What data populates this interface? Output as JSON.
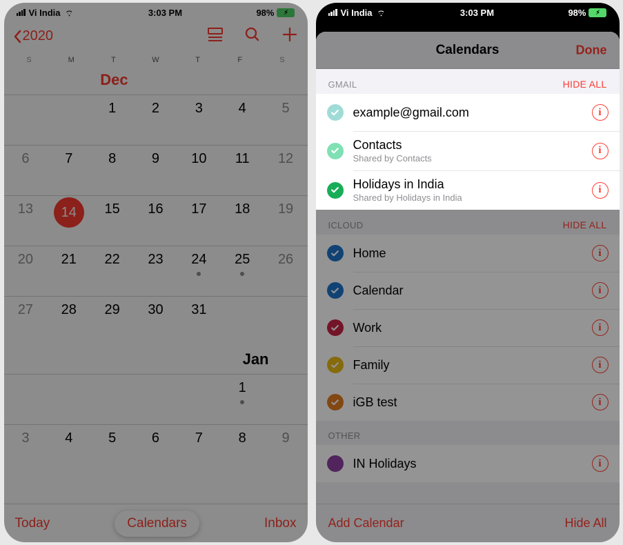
{
  "status": {
    "carrier": "Vi India",
    "time": "3:03 PM",
    "battery_pct": "98%",
    "battery_icon_text": "⚡︎"
  },
  "phone1": {
    "back_year": "2020",
    "weekdays": [
      "S",
      "M",
      "T",
      "W",
      "T",
      "F",
      "S"
    ],
    "month_dec": "Dec",
    "month_jan": "Jan",
    "rows": {
      "r1": [
        "",
        "",
        "1",
        "2",
        "3",
        "4",
        "5"
      ],
      "r2": [
        "6",
        "7",
        "8",
        "9",
        "10",
        "11",
        "12"
      ],
      "r3": [
        "13",
        "14",
        "15",
        "16",
        "17",
        "18",
        "19"
      ],
      "r4": [
        "20",
        "21",
        "22",
        "23",
        "24",
        "25",
        "26"
      ],
      "r5": [
        "27",
        "28",
        "29",
        "30",
        "31",
        "",
        ""
      ],
      "r7": [
        "",
        "",
        "",
        "",
        "",
        "1",
        ""
      ],
      "r8": [
        "3",
        "4",
        "5",
        "6",
        "7",
        "8",
        "9"
      ]
    },
    "bottom": {
      "today": "Today",
      "calendars": "Calendars",
      "inbox": "Inbox"
    }
  },
  "phone2": {
    "sheet_title": "Calendars",
    "done": "Done",
    "sections": {
      "gmail": {
        "label": "GMAIL",
        "hide": "HIDE ALL",
        "items": [
          {
            "name": "example@gmail.com",
            "sub": "",
            "color": "#9fdcd7"
          },
          {
            "name": "Contacts",
            "sub": "Shared by Contacts",
            "color": "#7fe0b3"
          },
          {
            "name": "Holidays in India",
            "sub": "Shared by Holidays in India",
            "color": "#18ad57"
          }
        ]
      },
      "icloud": {
        "label": "ICLOUD",
        "hide": "HIDE ALL",
        "items": [
          {
            "name": "Home",
            "color": "#1e73c9"
          },
          {
            "name": "Calendar",
            "color": "#1e73c9"
          },
          {
            "name": "Work",
            "color": "#c82446"
          },
          {
            "name": "Family",
            "color": "#e7b917"
          },
          {
            "name": "iGB test",
            "color": "#e07a1f"
          }
        ]
      },
      "other": {
        "label": "OTHER",
        "items": [
          {
            "name": "IN Holidays",
            "color": "#8c3fa0"
          }
        ]
      }
    },
    "bottom": {
      "add": "Add Calendar",
      "hide_all": "Hide All"
    }
  }
}
